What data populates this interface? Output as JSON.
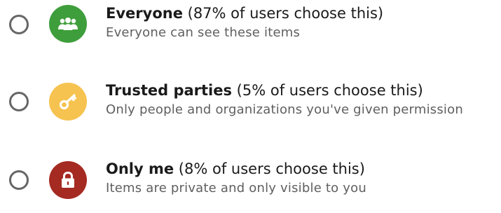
{
  "options": [
    {
      "title": "Everyone",
      "stat": " (87% of users choose this)",
      "description": "Everyone can see these items",
      "icon": "people-icon",
      "color": "#3f9e3c",
      "selected": false
    },
    {
      "title": "Trusted parties",
      "stat": " (5% of users choose this)",
      "description": "Only people and organizations you've given permission",
      "icon": "key-icon",
      "color": "#f6c350",
      "selected": false
    },
    {
      "title": "Only me",
      "stat": " (8% of users choose this)",
      "description": "Items are private and only visible to you",
      "icon": "lock-icon",
      "color": "#a52a22",
      "selected": false
    }
  ]
}
